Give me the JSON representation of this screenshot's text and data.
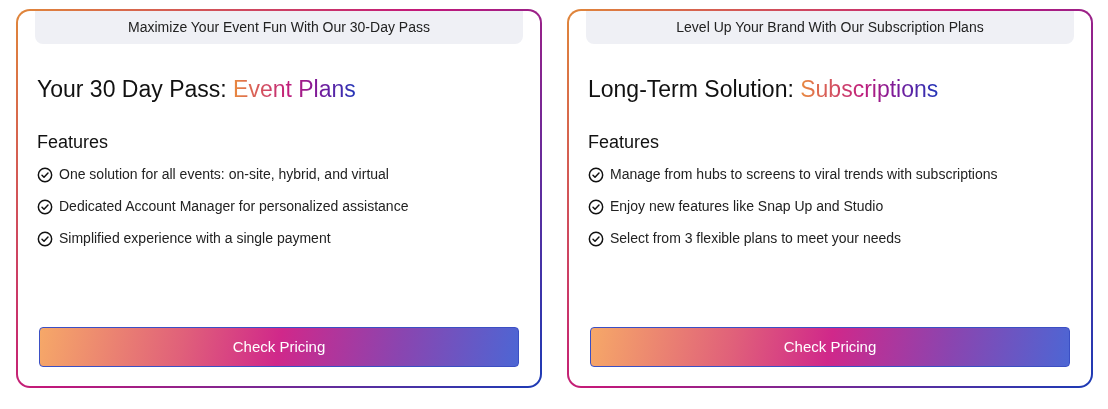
{
  "cards": [
    {
      "banner": "Maximize Your Event Fun With Our 30-Day Pass",
      "title": "Your 30 Day Pass:",
      "highlight": "Event Plans",
      "features_heading": "Features",
      "features": [
        "One solution for all events: on-site, hybrid, and virtual",
        "Dedicated Account Manager for personalized assistance",
        "Simplified experience with a single payment"
      ],
      "button": "Check Pricing"
    },
    {
      "banner": "Level Up Your Brand With Our Subscription Plans",
      "title": "Long-Term Solution:",
      "highlight": "Subscriptions",
      "features_heading": "Features",
      "features": [
        "Manage from hubs to screens to viral trends with subscriptions",
        "Enjoy new features like Snap Up and Studio",
        "Select from 3 flexible plans to meet your needs"
      ],
      "button": "Check Pricing"
    }
  ]
}
